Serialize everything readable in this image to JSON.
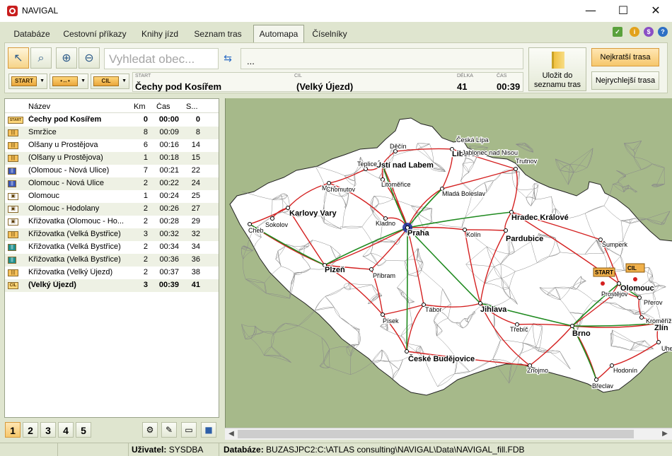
{
  "window": {
    "title": "NAVIGAL",
    "minimize": "—",
    "maximize": "☐",
    "close": "✕"
  },
  "tabs": [
    {
      "label": "Databáze"
    },
    {
      "label": "Cestovní příkazy"
    },
    {
      "label": "Knihy jízd"
    },
    {
      "label": "Seznam tras"
    },
    {
      "label": "Automapa"
    },
    {
      "label": "Číselníky"
    }
  ],
  "active_tab": "Automapa",
  "toolbar": {
    "search_placeholder": "Vyhledat obec...",
    "route_text": "...",
    "start_badge": "START",
    "via_badge": "•↔•",
    "cil_badge": "CIL",
    "start_label": "START",
    "cil_label": "CIL",
    "delka_label": "DÉLKA",
    "cas_label": "ČAS",
    "start_value": "Čechy pod Kosířem",
    "cil_value": "(Velký Újezd)",
    "delka_value": "41",
    "cas_value": "00:39",
    "save_label_1": "Uložit do",
    "save_label_2": "seznamu tras",
    "shortest": "Nejkratší trasa",
    "fastest": "Nejrychlejší trasa"
  },
  "list": {
    "headers": {
      "name": "Název",
      "km": "Km",
      "cas": "Čas",
      "s": "S..."
    },
    "rows": [
      {
        "icon": "start",
        "name": "Čechy pod Kosířem",
        "km": "0",
        "cas": "00:00",
        "s": "0",
        "bold": true
      },
      {
        "icon": "road",
        "name": "Smržice",
        "km": "8",
        "cas": "00:09",
        "s": "8"
      },
      {
        "icon": "road",
        "name": "Olšany u Prostějova",
        "km": "6",
        "cas": "00:16",
        "s": "14"
      },
      {
        "icon": "road",
        "name": " (Olšany u Prostějova)",
        "km": "1",
        "cas": "00:18",
        "s": "15"
      },
      {
        "icon": "highway",
        "name": " (Olomouc - Nová Ulice)",
        "km": "7",
        "cas": "00:21",
        "s": "22"
      },
      {
        "icon": "highway",
        "name": "Olomouc - Nová Ulice",
        "km": "2",
        "cas": "00:22",
        "s": "24"
      },
      {
        "icon": "city",
        "name": "Olomouc",
        "km": "1",
        "cas": "00:24",
        "s": "25"
      },
      {
        "icon": "city",
        "name": "Olomouc - Hodolany",
        "km": "2",
        "cas": "00:26",
        "s": "27"
      },
      {
        "icon": "city",
        "name": "Křižovatka (Olomouc - Ho...",
        "km": "2",
        "cas": "00:28",
        "s": "29"
      },
      {
        "icon": "road",
        "name": "Křižovatka (Velká Bystřice)",
        "km": "3",
        "cas": "00:32",
        "s": "32"
      },
      {
        "icon": "express",
        "name": "Křižovatka (Velká Bystřice)",
        "km": "2",
        "cas": "00:34",
        "s": "34"
      },
      {
        "icon": "express",
        "name": "Křižovatka (Velká Bystřice)",
        "km": "2",
        "cas": "00:36",
        "s": "36"
      },
      {
        "icon": "road",
        "name": "Křižovatka (Velký Újezd)",
        "km": "2",
        "cas": "00:37",
        "s": "38"
      },
      {
        "icon": "cil",
        "name": " (Velký Újezd)",
        "km": "3",
        "cas": "00:39",
        "s": "41",
        "bold": true
      }
    ]
  },
  "pages": [
    "1",
    "2",
    "3",
    "4",
    "5"
  ],
  "map": {
    "cities": [
      {
        "name": "Praha"
      },
      {
        "name": "Plzeň"
      },
      {
        "name": "Brno"
      },
      {
        "name": "Olomouc"
      },
      {
        "name": "Liberec"
      },
      {
        "name": "Ústí nad Labem"
      },
      {
        "name": "Karlovy Vary"
      },
      {
        "name": "Hradec Králové"
      },
      {
        "name": "Pardubice"
      },
      {
        "name": "České Budějovice"
      },
      {
        "name": "Zlín"
      },
      {
        "name": "Jihlava"
      }
    ],
    "towns": [
      "Děčín",
      "Česká Lípa",
      "Jablonec nad Nisou",
      "Teplice",
      "Most",
      "Chomutov",
      "Litoměřice",
      "Trutnov",
      "Mladá Boleslav",
      "Sokolov",
      "Cheb",
      "Kladno",
      "Kolín",
      "Šumperk",
      "Příbram",
      "Tábor",
      "Písek",
      "Třebíč",
      "Znojmo",
      "Hodonín",
      "Břeclav",
      "Prostějov",
      "Přerov",
      "Kroměříž",
      "Uherské Hradiště"
    ],
    "start_badge": "START",
    "cil_badge": "CIL"
  },
  "status": {
    "user_label": "Uživatel:",
    "user_value": "SYSDBA",
    "db_label": "Databáze:",
    "db_value": "BUZASJPC2:C:\\ATLAS consulting\\NAVIGAL\\Data\\NAVIGAL_fill.FDB"
  },
  "colors": {
    "panel_bg": "#dfe5cf",
    "map_bg": "#a6b98a",
    "main_road": "#d42020",
    "highway": "#1f8a1f",
    "badge": "#f0b04a"
  }
}
